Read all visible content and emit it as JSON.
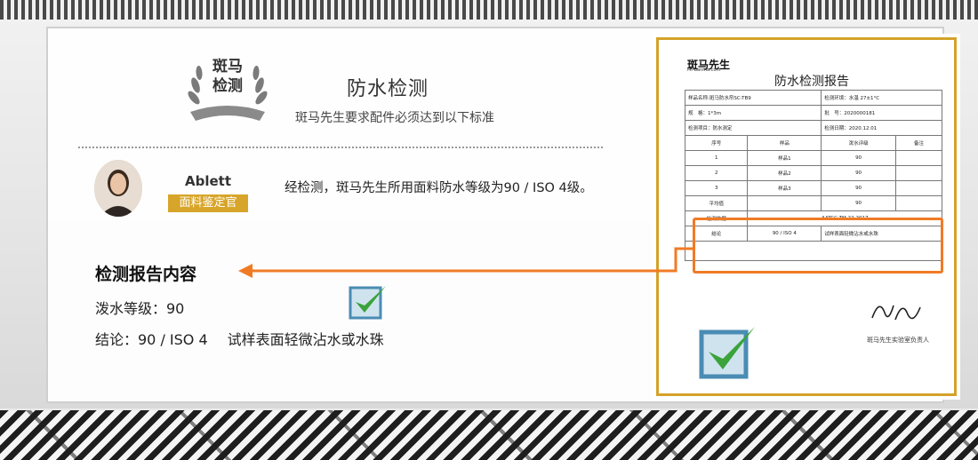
{
  "header": {
    "wreath_label": "斑马\n检测",
    "title": "防水检测",
    "subtitle": "斑马先生要求配件必须达到以下标准"
  },
  "inspector": {
    "name": "Ablett",
    "role": "面料鉴定官",
    "statement": "经检测，斑马先生所用面料防水等级为90 / ISO  4级。"
  },
  "report_summary": {
    "heading": "检测报告内容",
    "line1": "泼水等级：90",
    "line2_a": "结论：90 / ISO 4",
    "line2_b": "试样表面轻微沾水或水珠"
  },
  "report_doc": {
    "logo": "斑马先生",
    "logo_sub": "Mr-banma.com",
    "title": "防水检测报告",
    "rows": [
      [
        "样品名称:斑马防水帘SC-TB9",
        "检测环境：水温 27±1°C"
      ],
      [
        "规　格：1*3m",
        "批　号：2020000181"
      ],
      [
        "检测项目：防水测定",
        "检测日期：2020.12.01"
      ]
    ],
    "table_header": [
      "序号",
      "样品",
      "泼水评级",
      "备注"
    ],
    "table_rows": [
      [
        "1",
        "样品1",
        "90",
        ""
      ],
      [
        "2",
        "样品2",
        "90",
        ""
      ],
      [
        "3",
        "样品3",
        "90",
        ""
      ],
      [
        "平均值",
        "",
        "90",
        ""
      ]
    ],
    "basis_label": "检测依据",
    "basis_value": "AATCC TM 22-2017",
    "conclusion_label": "结论",
    "conclusion_value": "90 / ISO 4",
    "conclusion_note": "试样表面轻微沾水或水珠",
    "signature_label": "斑马先生实验室负责人"
  },
  "colors": {
    "accent_gold": "#d4a229",
    "highlight_orange": "#f07b25",
    "check_green": "#3aa33a"
  }
}
